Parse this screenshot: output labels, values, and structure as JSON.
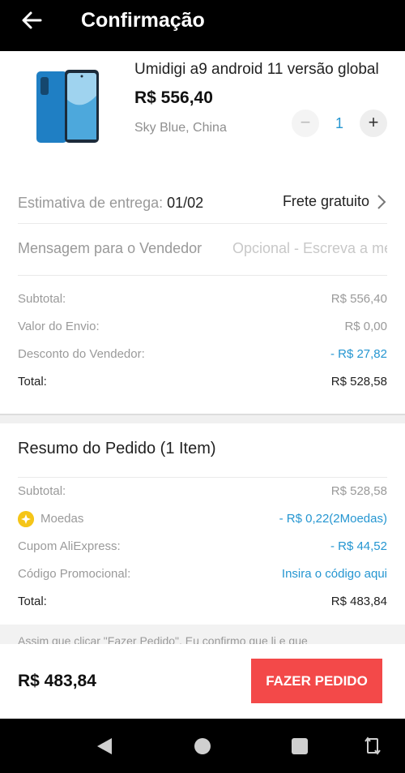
{
  "header": {
    "title": "Confirmação"
  },
  "product": {
    "title": "Umidigi a9 android 11 versão global",
    "price": "R$ 556,40",
    "variant": "Sky Blue, China",
    "qty_minus": "−",
    "quantity": "1",
    "qty_plus": "+"
  },
  "delivery": {
    "label": "Estimativa de entrega: ",
    "date": "01/02",
    "shipping": "Frete gratuito"
  },
  "message": {
    "label": "Mensagem para o Vendedor",
    "placeholder": "Opcional - Escreva a mensagem"
  },
  "summary": {
    "subtotal_label": "Subtotal:",
    "subtotal_value": "R$ 556,40",
    "shipping_label": "Valor do Envio:",
    "shipping_value": "R$ 0,00",
    "discount_label": "Desconto do Vendedor:",
    "discount_value": "- R$ 27,82",
    "total_label": "Total:",
    "total_value": "R$ 528,58"
  },
  "order": {
    "title": "Resumo do Pedido (1 Item)",
    "subtotal_label": "Subtotal:",
    "subtotal_value": "R$ 528,58",
    "coins_label": "Moedas",
    "coins_value": "- R$ 0,22(2Moedas)",
    "coupon_label": "Cupom AliExpress:",
    "coupon_value": "- R$ 44,52",
    "promo_label": "Código Promocional:",
    "promo_value": "Insira o código aqui",
    "total_label": "Total:",
    "total_value": "R$ 483,84"
  },
  "notice": "Assim que clicar \"Fazer Pedido\", Eu confirmo que li e que",
  "footer": {
    "total": "R$ 483,84",
    "place_order": "FAZER PEDIDO"
  },
  "colors": {
    "accent_blue": "#2596d1",
    "button_red": "#f34949",
    "coin_yellow": "#f5c518"
  },
  "icons": [
    "back-arrow-icon",
    "chevron-right-icon",
    "coin-icon",
    "nav-back-icon",
    "nav-home-icon",
    "nav-recent-icon",
    "rotate-icon"
  ]
}
